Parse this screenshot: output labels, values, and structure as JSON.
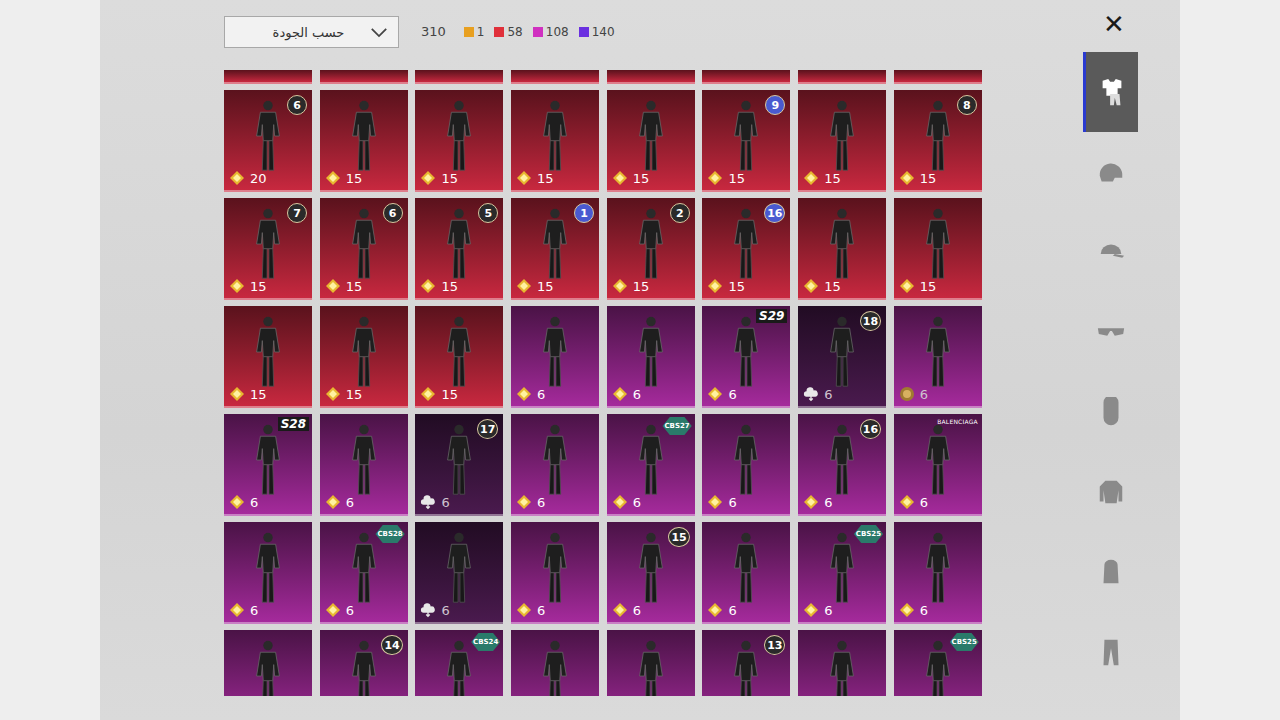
{
  "sort_dropdown": {
    "label": "حسب الجودة"
  },
  "total": "310",
  "counts": [
    {
      "value": "1",
      "color": "#e8a020"
    },
    {
      "value": "58",
      "color": "#e0303a"
    },
    {
      "value": "108",
      "color": "#d030c0"
    },
    {
      "value": "140",
      "color": "#6a30e0"
    }
  ],
  "close_button": "✕",
  "categories": [
    {
      "kind": "outfit",
      "selected": true
    },
    {
      "kind": "helmet",
      "selected": false
    },
    {
      "kind": "cap",
      "selected": false
    },
    {
      "kind": "glasses",
      "selected": false
    },
    {
      "kind": "mask",
      "selected": false
    },
    {
      "kind": "jacket",
      "selected": false
    },
    {
      "kind": "backpack",
      "selected": false
    },
    {
      "kind": "pants",
      "selected": false
    }
  ],
  "partial_row": [
    "#c8283f",
    "#c8283f",
    "#c8283f",
    "#c8283f",
    "#c8283f",
    "#c8283f",
    "#c8283f",
    "#c8283f"
  ],
  "items": [
    {
      "color": "#c8283f",
      "cost": "20",
      "currency": "diamond",
      "badge": {
        "text": "6",
        "kind": "circle",
        "color": "#2a2a2a"
      }
    },
    {
      "color": "#c8283f",
      "cost": "15",
      "currency": "diamond"
    },
    {
      "color": "#c8283f",
      "cost": "15",
      "currency": "diamond"
    },
    {
      "color": "#c8283f",
      "cost": "15",
      "currency": "diamond"
    },
    {
      "color": "#c8283f",
      "cost": "15",
      "currency": "diamond"
    },
    {
      "color": "#c8283f",
      "cost": "15",
      "currency": "diamond",
      "badge": {
        "text": "9",
        "kind": "circle",
        "color": "#4a5ad0"
      }
    },
    {
      "color": "#c8283f",
      "cost": "15",
      "currency": "diamond"
    },
    {
      "color": "#c8283f",
      "cost": "15",
      "currency": "diamond",
      "badge": {
        "text": "8",
        "kind": "circle",
        "color": "#2a2a2a"
      }
    },
    {
      "color": "#c8283f",
      "cost": "15",
      "currency": "diamond",
      "badge": {
        "text": "7",
        "kind": "circle",
        "color": "#2a2a2a"
      }
    },
    {
      "color": "#c8283f",
      "cost": "15",
      "currency": "diamond",
      "badge": {
        "text": "6",
        "kind": "circle",
        "color": "#2a2a2a"
      }
    },
    {
      "color": "#c8283f",
      "cost": "15",
      "currency": "diamond",
      "badge": {
        "text": "5",
        "kind": "circle",
        "color": "#2a2a2a"
      }
    },
    {
      "color": "#c8283f",
      "cost": "15",
      "currency": "diamond",
      "badge": {
        "text": "1",
        "kind": "circle",
        "color": "#4a5ad0"
      }
    },
    {
      "color": "#c8283f",
      "cost": "15",
      "currency": "diamond",
      "badge": {
        "text": "2",
        "kind": "circle",
        "color": "#2a2a2a"
      }
    },
    {
      "color": "#c8283f",
      "cost": "15",
      "currency": "diamond",
      "badge": {
        "text": "16",
        "kind": "circle",
        "color": "#4a5ad0"
      }
    },
    {
      "color": "#c8283f",
      "cost": "15",
      "currency": "diamond"
    },
    {
      "color": "#c8283f",
      "cost": "15",
      "currency": "diamond"
    },
    {
      "color": "#c8283f",
      "cost": "15",
      "currency": "diamond"
    },
    {
      "color": "#c8283f",
      "cost": "15",
      "currency": "diamond"
    },
    {
      "color": "#c8283f",
      "cost": "15",
      "currency": "diamond"
    },
    {
      "color": "#a52a9c",
      "cost": "6",
      "currency": "diamond"
    },
    {
      "color": "#a52a9c",
      "cost": "6",
      "currency": "diamond"
    },
    {
      "color": "#a52a9c",
      "cost": "6",
      "currency": "diamond",
      "badge": {
        "text": "S29",
        "kind": "tag",
        "color": "#ffffff"
      }
    },
    {
      "color": "#4a1a4e",
      "cost": "6",
      "currency": "cloud",
      "badge": {
        "text": "18",
        "kind": "circle",
        "color": "#2a2a2a"
      }
    },
    {
      "color": "#a52a9c",
      "cost": "6",
      "currency": "coin"
    },
    {
      "color": "#a52a9c",
      "cost": "6",
      "currency": "diamond",
      "badge": {
        "text": "S28",
        "kind": "tag",
        "color": "#ffffff"
      }
    },
    {
      "color": "#a52a9c",
      "cost": "6",
      "currency": "diamond"
    },
    {
      "color": "#4a1a4e",
      "cost": "6",
      "currency": "cloud",
      "badge": {
        "text": "17",
        "kind": "circle",
        "color": "#2a2a2a"
      }
    },
    {
      "color": "#a52a9c",
      "cost": "6",
      "currency": "diamond"
    },
    {
      "color": "#a52a9c",
      "cost": "6",
      "currency": "diamond",
      "badge": {
        "text": "CBS27",
        "kind": "hex",
        "color": "#2a7a6a"
      }
    },
    {
      "color": "#a52a9c",
      "cost": "6",
      "currency": "diamond"
    },
    {
      "color": "#a52a9c",
      "cost": "6",
      "currency": "diamond",
      "badge": {
        "text": "16",
        "kind": "circle",
        "color": "#2a2a2a"
      }
    },
    {
      "color": "#a52a9c",
      "cost": "6",
      "currency": "diamond",
      "badge": {
        "text": "BALENCIAGA",
        "kind": "brand",
        "color": "#ffffff"
      }
    },
    {
      "color": "#a52a9c",
      "cost": "6",
      "currency": "diamond"
    },
    {
      "color": "#a52a9c",
      "cost": "6",
      "currency": "diamond",
      "badge": {
        "text": "CBS28",
        "kind": "hex",
        "color": "#2a7a6a"
      }
    },
    {
      "color": "#4a1a4e",
      "cost": "6",
      "currency": "cloud"
    },
    {
      "color": "#a52a9c",
      "cost": "6",
      "currency": "diamond"
    },
    {
      "color": "#a52a9c",
      "cost": "6",
      "currency": "diamond",
      "badge": {
        "text": "15",
        "kind": "circle",
        "color": "#2a2a2a"
      }
    },
    {
      "color": "#a52a9c",
      "cost": "6",
      "currency": "diamond"
    },
    {
      "color": "#a52a9c",
      "cost": "6",
      "currency": "diamond",
      "badge": {
        "text": "CBS25",
        "kind": "hex",
        "color": "#2a7a6a"
      }
    },
    {
      "color": "#a52a9c",
      "cost": "6",
      "currency": "diamond"
    },
    {
      "color": "#a52a9c"
    },
    {
      "color": "#a52a9c",
      "badge": {
        "text": "14",
        "kind": "circle",
        "color": "#2a2a2a"
      }
    },
    {
      "color": "#a52a9c",
      "badge": {
        "text": "CBS24",
        "kind": "hex",
        "color": "#2a7a6a"
      }
    },
    {
      "color": "#a52a9c"
    },
    {
      "color": "#a52a9c"
    },
    {
      "color": "#a52a9c",
      "badge": {
        "text": "13",
        "kind": "circle",
        "color": "#2a2a2a"
      }
    },
    {
      "color": "#a52a9c"
    },
    {
      "color": "#a52a9c",
      "badge": {
        "text": "CBS25",
        "kind": "hex",
        "color": "#2a7a6a"
      }
    }
  ]
}
